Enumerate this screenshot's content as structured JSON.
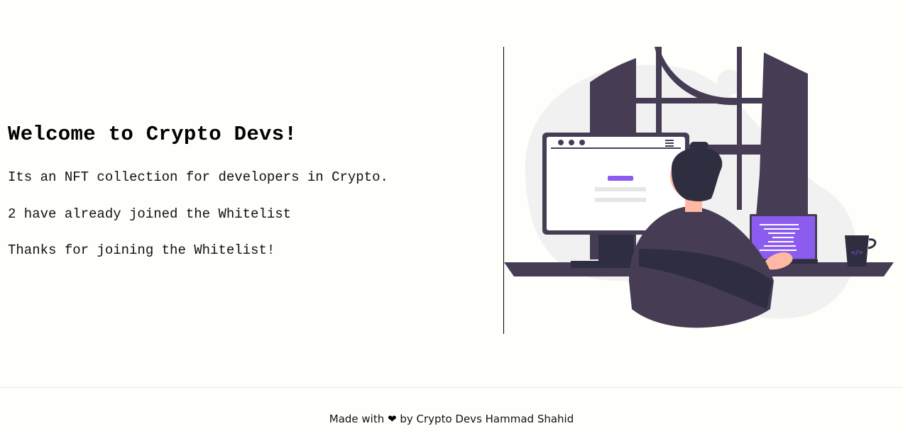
{
  "hero": {
    "title": "Welcome to Crypto Devs!",
    "description": "Its an NFT collection for developers in Crypto.",
    "joined_count": "2 have already joined the Whitelist",
    "status_message": "Thanks for joining the Whitelist!"
  },
  "illustration": {
    "name": "developer-at-desk-illustration",
    "accent_color": "#8c5cf0",
    "dark_color": "#463d54"
  },
  "footer": {
    "prefix": "Made with",
    "heart_icon": "heart-icon",
    "suffix": "by Crypto Devs Hammad Shahid"
  }
}
